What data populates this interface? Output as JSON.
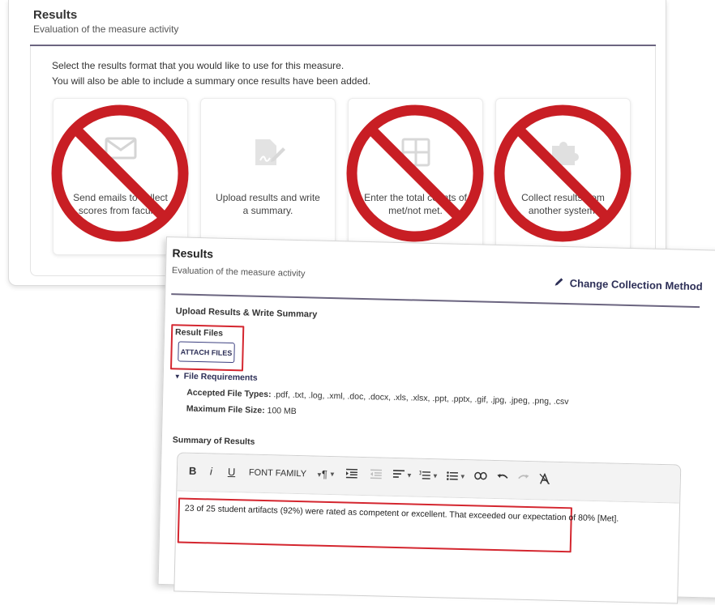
{
  "back": {
    "title": "Results",
    "subtitle": "Evaluation of the measure activity",
    "intro_line1": "Select the results format that you would like to use for this measure.",
    "intro_line2": "You will also be able to include a summary once results have been added.",
    "cards": [
      {
        "line1": "Send emails to collect",
        "line2": "scores from faculty.",
        "icon": "envelope-icon",
        "prohibited": true
      },
      {
        "line1": "Upload results and write",
        "line2": "a summary.",
        "icon": "upload-document-icon",
        "prohibited": false
      },
      {
        "line1": "Enter the total counts of",
        "line2": "met/not met.",
        "icon": "counts-grid-icon",
        "prohibited": true
      },
      {
        "line1": "Collect results from",
        "line2": "another system.",
        "icon": "puzzle-icon",
        "prohibited": true
      }
    ],
    "prohibit_color": "#c81e24"
  },
  "front": {
    "title": "Results",
    "subtitle": "Evaluation of the measure activity",
    "change_collection_label": "Change Collection Method",
    "upload_heading": "Upload Results & Write Summary",
    "result_files_label": "Result Files",
    "attach_files_label": "ATTACH FILES",
    "file_requirements_label": "File Requirements",
    "accepted_types_label": "Accepted File Types:",
    "accepted_types_value": ".pdf, .txt, .log, .xml, .doc, .docx, .xls, .xlsx, .ppt, .pptx, .gif, .jpg, .jpeg, .png, .csv",
    "max_size_label": "Maximum File Size:",
    "max_size_value": "100 MB",
    "summary_label": "Summary of Results",
    "toolbar": {
      "bold": "B",
      "italic": "i",
      "underline": "U",
      "font_family": "FONT FAMILY",
      "paragraph": "¶"
    },
    "summary_line1": "23 of 25 student artifacts (92%) were rated as competent or excellent. That exceeded our expectation of 80% [Met].",
    "highlight_color": "#d4262f",
    "accent_color": "#2d2f57"
  }
}
